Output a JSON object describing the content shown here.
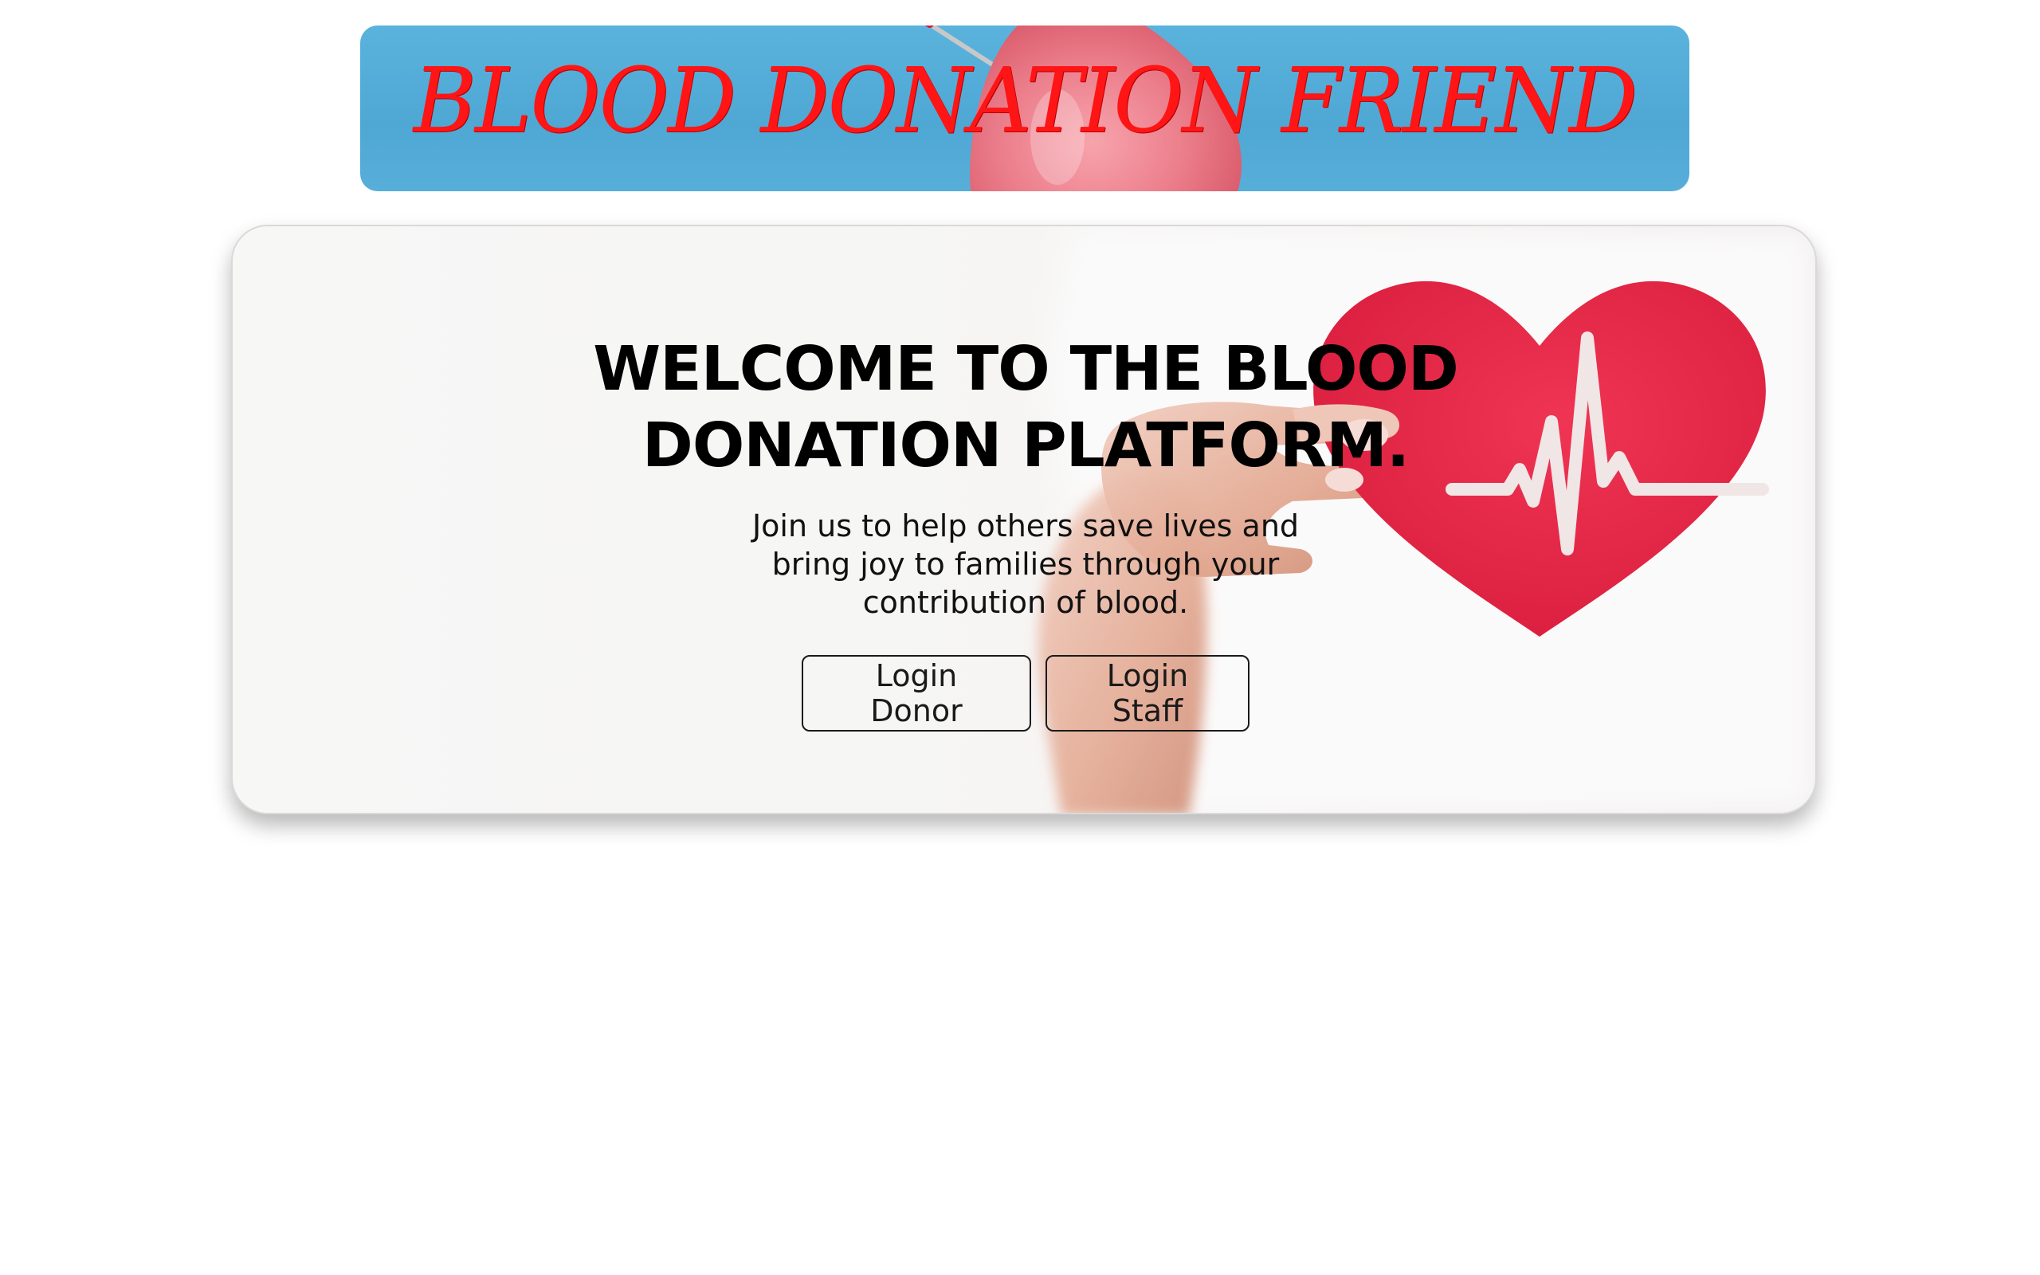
{
  "banner": {
    "title": "BLOOD DONATION FRIEND",
    "background_color": "#54aad6",
    "title_color": "#ff1515"
  },
  "hero": {
    "title": "WELCOME TO THE BLOOD DONATION PLATFORM.",
    "subtitle": "Join us to help others save lives and bring joy to families through your contribution of blood.",
    "heart_color": "#e8294b",
    "buttons": {
      "donor_label": "Login Donor",
      "staff_label": "Login Staff"
    }
  }
}
